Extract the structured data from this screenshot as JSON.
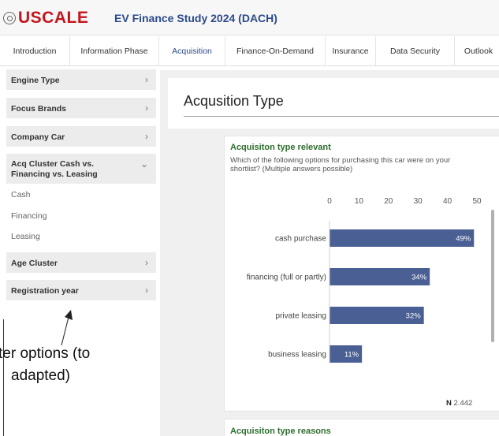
{
  "header": {
    "logo_text": "USCALE",
    "study_title": "EV Finance Study 2024 (DACH)"
  },
  "tabs": [
    {
      "label": "Introduction"
    },
    {
      "label": "Information Phase"
    },
    {
      "label": "Acquisition"
    },
    {
      "label": "Finance-On-Demand"
    },
    {
      "label": "Insurance"
    },
    {
      "label": "Data Security"
    },
    {
      "label": "Outlook"
    }
  ],
  "sidebar": {
    "items": [
      {
        "label": "Engine Type"
      },
      {
        "label": "Focus Brands"
      },
      {
        "label": "Company Car"
      },
      {
        "label_line1": "Acq Cluster Cash vs.",
        "label_line2": "Financing vs. Leasing"
      },
      {
        "label": "Age Cluster"
      },
      {
        "label": "Registration year"
      }
    ],
    "sub_items": [
      {
        "label": "Cash"
      },
      {
        "label": "Financing"
      },
      {
        "label": "Leasing"
      }
    ]
  },
  "annotation": {
    "line1": "ter options (to",
    "line2": "adapted)"
  },
  "main": {
    "title": "Acqusition Type",
    "question_title": "Acquisiton type relevant",
    "question_text": "Which of the following options for purchasing this car were on your shortlist? (Multiple answers possible)",
    "n_prefix": "N",
    "n_value": "2.442",
    "next_card_title": "Acquisiton type reasons"
  },
  "chart_data": {
    "type": "bar",
    "orientation": "horizontal",
    "categories": [
      "cash purchase",
      "financing (full or partly)",
      "private leasing",
      "business leasing"
    ],
    "values": [
      49,
      34,
      32,
      11
    ],
    "value_labels": [
      "49%",
      "34%",
      "32%",
      "11%"
    ],
    "xlim": [
      0,
      50
    ],
    "xticks": [
      "0",
      "10",
      "20",
      "30",
      "40",
      "50"
    ],
    "bar_color": "#4a5f94",
    "axis_position": "top"
  }
}
